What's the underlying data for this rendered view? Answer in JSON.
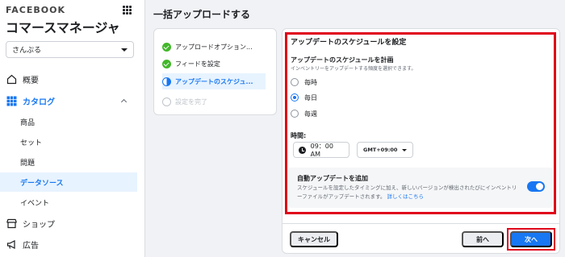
{
  "sidebar": {
    "brand": "FACEBOOK",
    "app_title": "コマースマネージャ",
    "account": "さんぷる",
    "nav": {
      "overview": "概要",
      "catalog": "カタログ",
      "products": "商品",
      "sets": "セット",
      "issues": "問題",
      "data_sources": "データソース",
      "events": "イベント",
      "shop": "ショップ",
      "ads": "広告"
    }
  },
  "page": {
    "title": "一括アップロードする"
  },
  "steps": [
    {
      "label": "アップロードオプション...",
      "state": "done"
    },
    {
      "label": "フィードを設定",
      "state": "done"
    },
    {
      "label": "アップデートのスケジュ...",
      "state": "current"
    },
    {
      "label": "設定を完了",
      "state": "todo"
    }
  ],
  "schedule": {
    "section_title": "アップデートのスケジュールを設定",
    "subtitle": "アップデートのスケジュールを計画",
    "description": "インベントリーをアップデートする頻度を選択できます。",
    "options": [
      {
        "label": "毎時",
        "checked": false
      },
      {
        "label": "毎日",
        "checked": true
      },
      {
        "label": "毎週",
        "checked": false
      }
    ],
    "time_label": "時間:",
    "time_value": "09：00 AM",
    "timezone": "GMT+09:00"
  },
  "auto_update": {
    "title": "自動アップデートを追加",
    "description": "スケジュールを設定したタイミングに加え、新しいバージョンが検出されたびにインベントリーファイルがアップデートされます。",
    "link": "詳しくはこちら",
    "enabled": true
  },
  "footer": {
    "cancel": "キャンセル",
    "prev": "前へ",
    "next": "次へ"
  },
  "colors": {
    "accent": "#1877f2",
    "highlight": "#e0001b",
    "done": "#42b72a"
  }
}
